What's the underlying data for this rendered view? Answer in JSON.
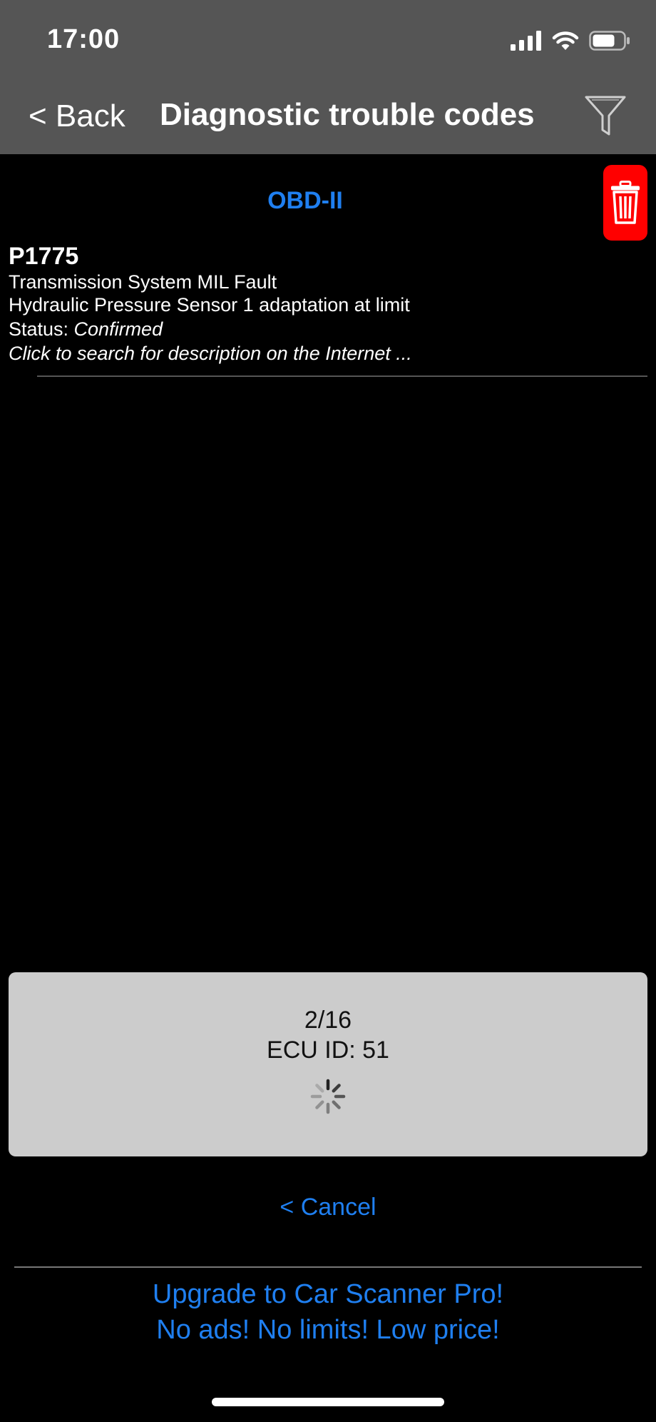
{
  "status_bar": {
    "time": "17:00",
    "icons": [
      "cellular-signal-icon",
      "wifi-icon",
      "battery-icon"
    ]
  },
  "nav": {
    "back_label": "< Back",
    "title": "Diagnostic trouble codes",
    "filter_icon": "filter-icon"
  },
  "section": {
    "header": "OBD-II",
    "delete_icon": "trash-icon"
  },
  "dtc": {
    "code": "P1775",
    "line1": "Transmission System MIL Fault",
    "line2": "Hydraulic Pressure Sensor 1 adaptation at limit",
    "status_label": "Status: ",
    "status_value": "Confirmed",
    "search_hint": "Click to search for description on the Internet ..."
  },
  "progress": {
    "count": "2/16",
    "ecu": "ECU ID: 51"
  },
  "cancel_label": "< Cancel",
  "promo": {
    "line1": "Upgrade to Car Scanner Pro!",
    "line2": "No ads! No limits! Low price!"
  },
  "colors": {
    "bar_background": "#555555",
    "accent_blue": "#1f7ff0",
    "delete_red": "#ff0000",
    "panel_gray": "#cccccc"
  }
}
